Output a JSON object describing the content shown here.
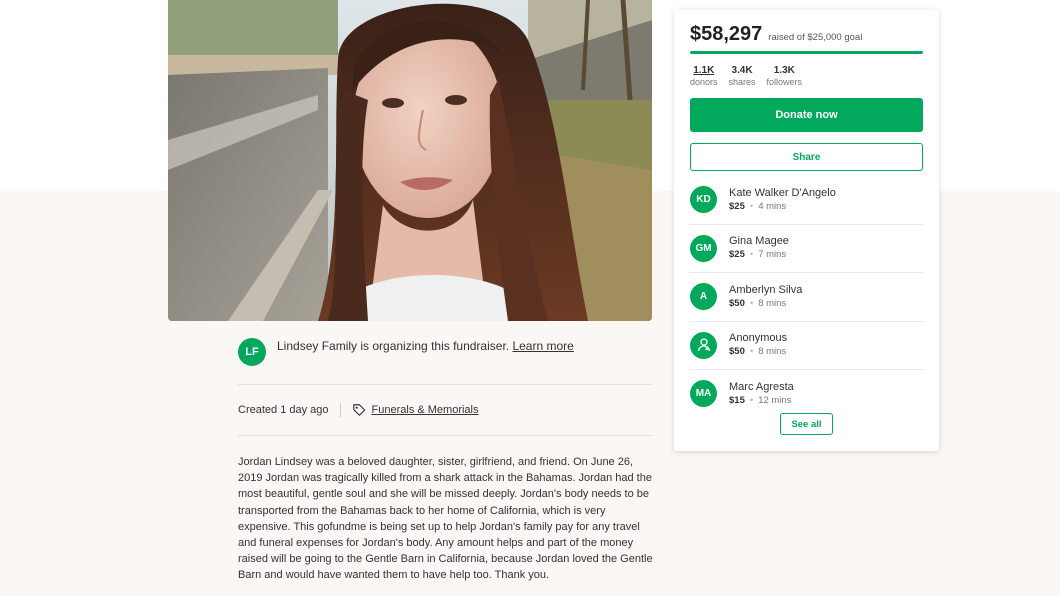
{
  "campaign": {
    "photo_alt": "Jordan Lindsey",
    "organizer": {
      "initials": "LF",
      "text": "Lindsey Family is organizing this fundraiser.",
      "learn_more": "Learn more"
    },
    "created": "Created 1 day ago",
    "category": "Funerals & Memorials",
    "story": "Jordan Lindsey was a beloved daughter, sister, girlfriend, and friend. On June 26, 2019 Jordan was tragically killed from a shark attack in the Bahamas. Jordan had the most beautiful, gentle soul and she will be missed deeply. Jordan's body needs to be transported from the Bahamas back to her home of California, which is very expensive. This gofundme is being set up to help Jordan's family pay for any travel and funeral expenses for Jordan's body. Any amount helps and part of the money raised will be going to the Gentle Barn in California, because Jordan loved the Gentle Barn and would have wanted them to have help too. Thank you."
  },
  "sidebar": {
    "raised": "$58,297",
    "goal_text": "raised of $25,000 goal",
    "progress_percent": 100,
    "stats": [
      {
        "value": "1.1K",
        "label": "donors"
      },
      {
        "value": "3.4K",
        "label": "shares"
      },
      {
        "value": "1.3K",
        "label": "followers"
      }
    ],
    "donate_label": "Donate now",
    "share_label": "Share",
    "see_all_label": "See all",
    "donations": [
      {
        "initials": "KD",
        "name": "Kate Walker D'Angelo",
        "amount": "$25",
        "time": "4 mins"
      },
      {
        "initials": "GM",
        "name": "Gina Magee",
        "amount": "$25",
        "time": "7 mins"
      },
      {
        "initials": "A",
        "name": "Amberlyn Silva",
        "amount": "$50",
        "time": "8 mins"
      },
      {
        "initials": "",
        "name": "Anonymous",
        "amount": "$50",
        "time": "8 mins",
        "icon": "anonymous-user-icon"
      },
      {
        "initials": "MA",
        "name": "Marc Agresta",
        "amount": "$15",
        "time": "12 mins"
      }
    ]
  },
  "colors": {
    "brand_green": "#02a95c",
    "page_background": "#faf7f4"
  }
}
